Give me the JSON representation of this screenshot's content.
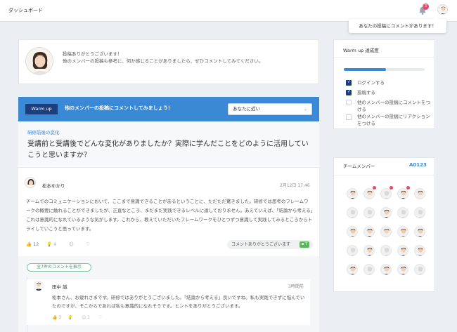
{
  "header": {
    "title": "ダッシュボード",
    "notification_count": "3",
    "notification_popup": "あなたの投稿にコメントがあります！"
  },
  "welcome": {
    "line1": "投稿ありがとうございます！",
    "line2": "他のメンバーの投稿も参考に、何か感じることがありましたら、ぜひコメントしてみてください。"
  },
  "thread": {
    "badge": "Warm up",
    "instruction": "他のメンバーの投稿にコメントしてみましょう！",
    "filter_selected": "あなたに近い",
    "topic_label": "研修前後の変化",
    "topic_question": "受講前と受講後でどんな変化がありましたか？実際に学んだことをどのように活用していこうと思いますか？",
    "post": {
      "author": "松本ゆかり",
      "date": "2月12日 17:46",
      "body": "チームでのコミュニケーションにおいて、ここまで意識できることがあるということに、ただただ驚きました。研修では思考のフレームワークの概要に触れることができましたが、正直なところ、まだまだ実践できるレベルに達しておりません。あえていえば、「結論から考える」これは意識的になれているような気がします。これから、教えていただいたフレームワークをひとつずつ意識して実践してみるところからトライしていこうと思っています。",
      "likes": "12",
      "idea_count": "4",
      "thanks_label": "コメントありがとうございます",
      "comment_count": "7"
    },
    "show_all_comments": "全7件のコメントを表示",
    "reply": {
      "author": "田中 誠",
      "time": "3時間前",
      "body": "松本さん、お疲れさまです。研修ではありがとうございました。「結論から考える」良いですね。私も実践できずに悩んでいたのですが、そこからであれば私も意識的になれそうです。ヒントをありがとうございます。",
      "likes": "3",
      "smile_count": "1"
    }
  },
  "warmup_panel": {
    "title": "Warm up 達成度",
    "progress_fraction": 0.52,
    "tasks": [
      {
        "label": "ログインする",
        "done": true
      },
      {
        "label": "投稿する",
        "done": true
      },
      {
        "label": "他のメンバーの投稿にコメントをつける",
        "done": false
      },
      {
        "label": "他のメンバーの投稿にリアクションをつける",
        "done": false
      }
    ]
  },
  "team_panel": {
    "title": "チームメンバー",
    "team_code": "A0123"
  },
  "colors": {
    "accent": "#3b88d4",
    "navy": "#1b3e7d",
    "badge": "#e84a6f",
    "green": "#5cb85c"
  }
}
